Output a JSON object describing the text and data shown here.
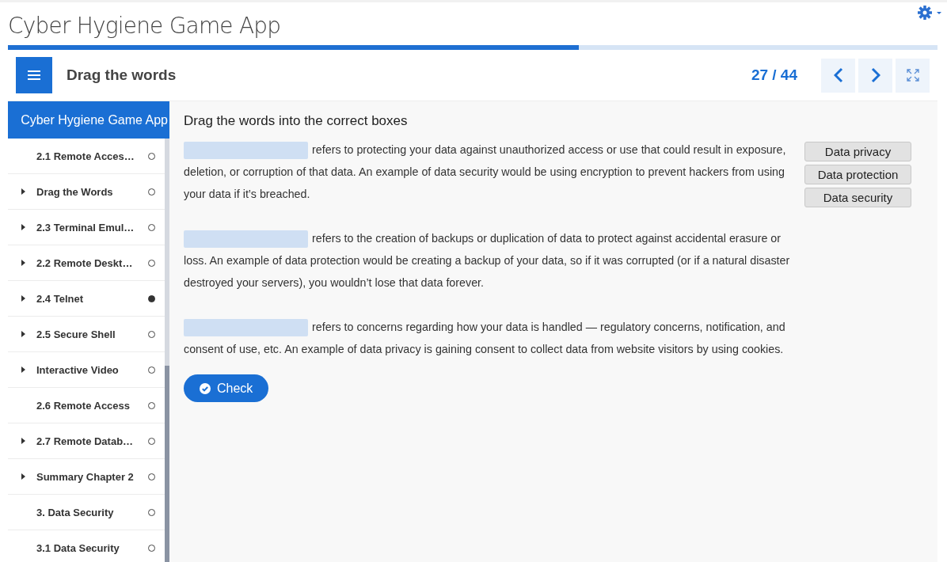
{
  "app_title": "Cyber Hygiene Game App",
  "progress": {
    "level": 0.614
  },
  "header": {
    "title": "Drag the words",
    "counter": "27 / 44"
  },
  "sidebar": {
    "title": "Cyber Hygiene Game App",
    "items": [
      {
        "label": "2.1 Remote Acces…",
        "expandable": false,
        "done": false
      },
      {
        "label": "Drag the Words",
        "expandable": true,
        "done": false
      },
      {
        "label": "2.3 Terminal Emul…",
        "expandable": true,
        "done": false
      },
      {
        "label": "2.2 Remote Deskt…",
        "expandable": true,
        "done": false
      },
      {
        "label": "2.4 Telnet",
        "expandable": true,
        "done": true
      },
      {
        "label": "2.5 Secure Shell",
        "expandable": true,
        "done": false
      },
      {
        "label": "Interactive Video",
        "expandable": true,
        "done": false
      },
      {
        "label": "2.6 Remote Access",
        "expandable": false,
        "done": false
      },
      {
        "label": "2.7 Remote Datab…",
        "expandable": true,
        "done": false
      },
      {
        "label": "Summary Chapter 2",
        "expandable": true,
        "done": false
      },
      {
        "label": "3. Data Security",
        "expandable": false,
        "done": false
      },
      {
        "label": "3.1 Data Security",
        "expandable": false,
        "done": false
      }
    ]
  },
  "task": {
    "instruction": "Drag the words into the correct boxes",
    "paragraphs": [
      "refers to protecting your data against unauthorized access or use that could result in exposure, deletion, or corruption of that data. An example of data security would be using encryption to prevent hackers from using your data if it’s breached.",
      "refers to the creation of backups or duplication of data to protect against accidental erasure or loss. An example of data protection would be creating a backup of your data, so if it was corrupted (or if a natural disaster destroyed your servers), you wouldn’t lose that data forever.",
      "refers to concerns regarding how your data is handled — regulatory concerns, notification, and consent of use, etc. An example of data privacy is gaining consent to collect data from website visitors by using cookies."
    ],
    "words": [
      "Data privacy",
      "Data protection",
      "Data security"
    ],
    "check_button": "Check"
  }
}
